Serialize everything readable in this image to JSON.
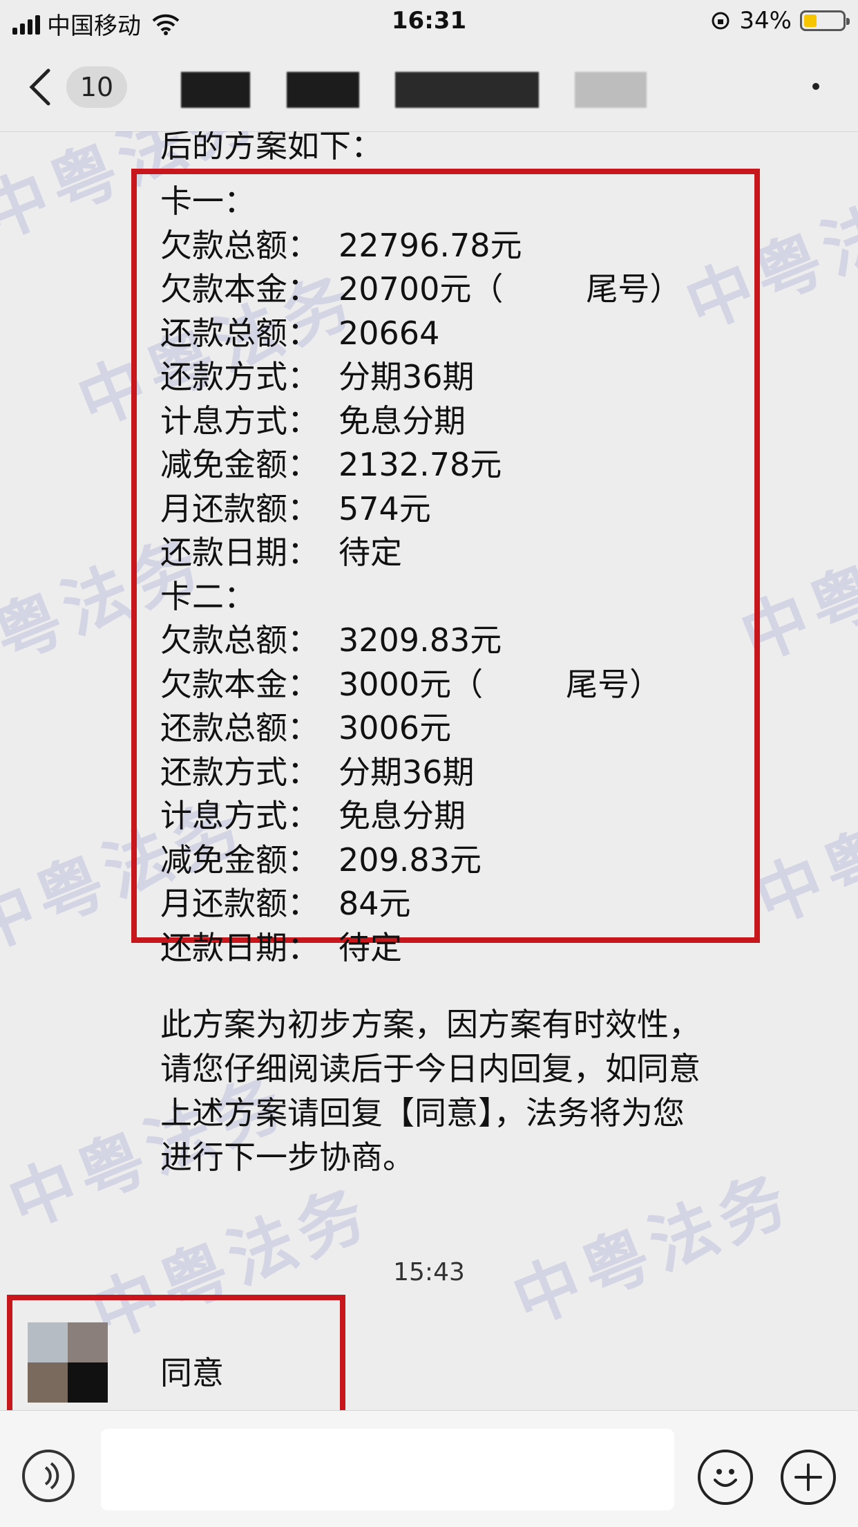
{
  "status_bar": {
    "carrier": "中国移动",
    "time": "16:31",
    "battery_percent": "34%",
    "battery_level": 0.34
  },
  "nav": {
    "unread_count": "10"
  },
  "chat": {
    "intro": "后的方案如下：",
    "card_one": {
      "header": "卡一：",
      "rows": [
        {
          "label": "欠款总额：",
          "value": "22796.78元"
        },
        {
          "label": "欠款本金：",
          "value": "20700元（",
          "suffix": "尾号）"
        },
        {
          "label": "还款总额：",
          "value": "20664"
        },
        {
          "label": "还款方式：",
          "value": "分期36期"
        },
        {
          "label": "计息方式：",
          "value": "免息分期"
        },
        {
          "label": "减免金额：",
          "value": "2132.78元"
        },
        {
          "label": "月还款额：",
          "value": "574元"
        },
        {
          "label": "还款日期：",
          "value": "待定"
        }
      ]
    },
    "card_two": {
      "header": "卡二：",
      "rows": [
        {
          "label": "欠款总额：",
          "value": "3209.83元"
        },
        {
          "label": "欠款本金：",
          "value": "3000元（",
          "suffix": "尾号）"
        },
        {
          "label": "还款总额：",
          "value": "3006元"
        },
        {
          "label": "还款方式：",
          "value": "分期36期"
        },
        {
          "label": "计息方式：",
          "value": "免息分期"
        },
        {
          "label": "减免金额：",
          "value": "209.83元"
        },
        {
          "label": "月还款额：",
          "value": "84元"
        },
        {
          "label": "还款日期：",
          "value": "待定"
        }
      ]
    },
    "follow_up": "此方案为初步方案，因方案有时效性，请您仔细阅读后于今日内回复，如同意上述方案请回复【同意】，法务将为您进行下一步协商。",
    "timestamp": "15:43",
    "incoming_message": "同意",
    "watermark": "中粤法务"
  }
}
